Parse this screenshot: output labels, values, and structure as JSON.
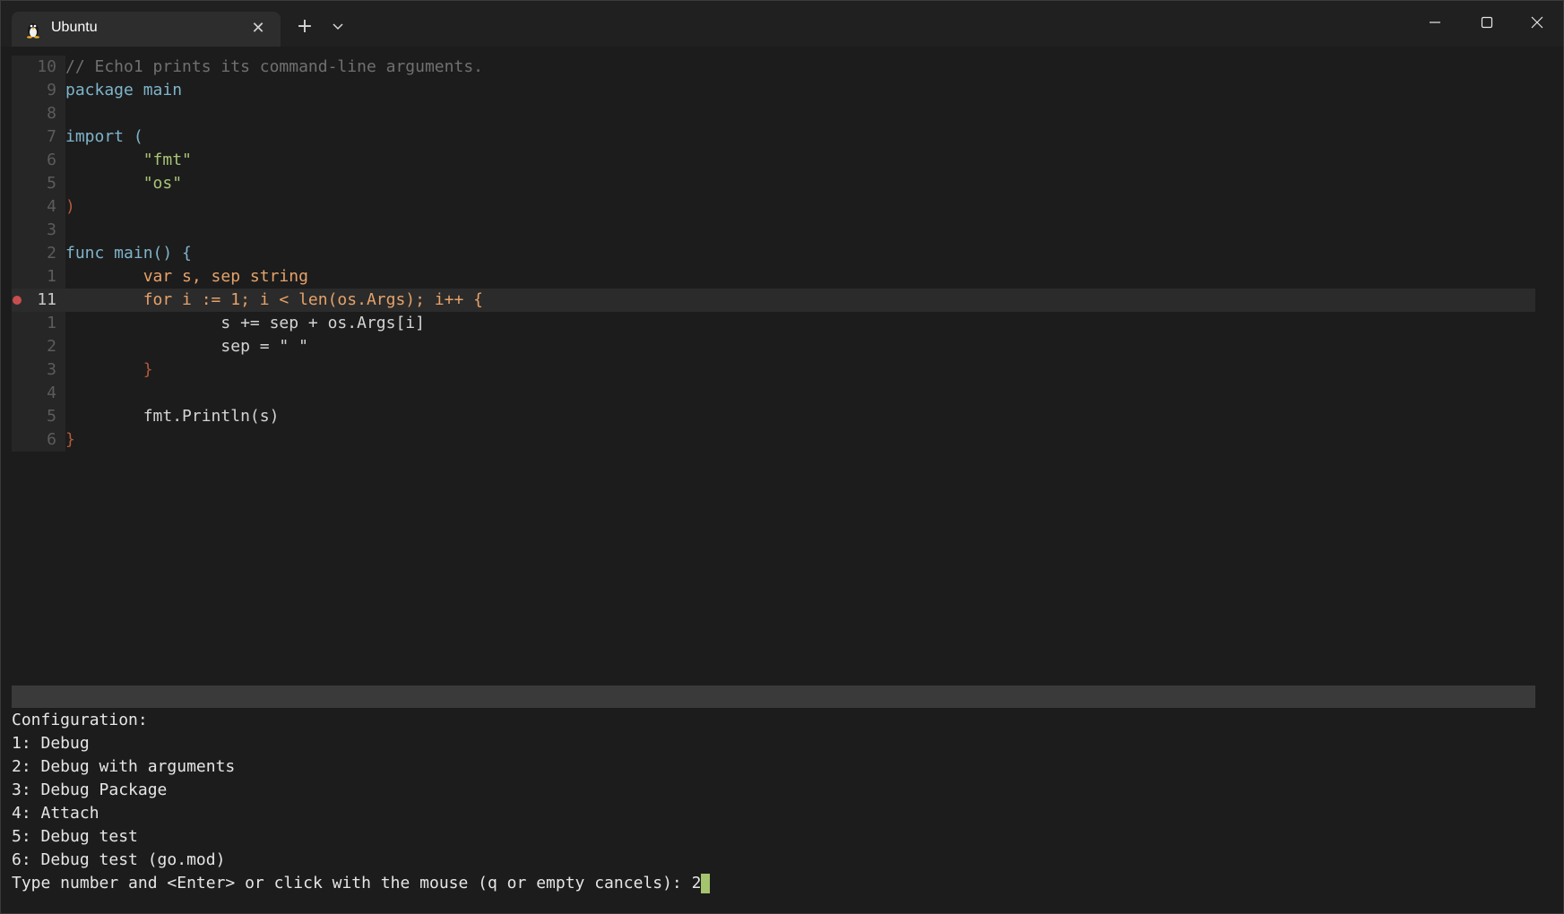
{
  "window": {
    "tab_title": "Ubuntu",
    "tab_icon": "linux-penguin-icon",
    "new_tab_icon": "plus-icon",
    "dropdown_icon": "chevron-down-icon",
    "controls": [
      "minimize-icon",
      "maximize-icon",
      "close-icon"
    ]
  },
  "editor": {
    "lines": [
      {
        "num": "10",
        "text": "// Echo1 prints its command-line arguments."
      },
      {
        "num": "9",
        "text": "package main"
      },
      {
        "num": "8",
        "text": ""
      },
      {
        "num": "7",
        "text": "import ("
      },
      {
        "num": "6",
        "text": "        \"fmt\""
      },
      {
        "num": "5",
        "text": "        \"os\""
      },
      {
        "num": "4",
        "text": ")"
      },
      {
        "num": "3",
        "text": ""
      },
      {
        "num": "2",
        "text": "func main() {"
      },
      {
        "num": "1",
        "text": "        var s, sep string"
      },
      {
        "num": "11",
        "text": "        for i := 1; i < len(os.Args); i++ {",
        "current": true,
        "breakpoint": true
      },
      {
        "num": "1",
        "text": "                s += sep + os.Args[i]"
      },
      {
        "num": "2",
        "text": "                sep = \" \""
      },
      {
        "num": "3",
        "text": "        }"
      },
      {
        "num": "4",
        "text": ""
      },
      {
        "num": "5",
        "text": "        fmt.Println(s)"
      },
      {
        "num": "6",
        "text": "}"
      }
    ]
  },
  "prompt": {
    "header": "Configuration:",
    "options": [
      "1: Debug",
      "2: Debug with arguments",
      "3: Debug Package",
      "4: Attach",
      "5: Debug test",
      "6: Debug test (go.mod)"
    ],
    "question": "Type number and <Enter> or click with the mouse (q or empty cancels): ",
    "input_value": "2"
  },
  "colors": {
    "background": "#1c1c1c",
    "breakpoint": "#c74e4e",
    "cursor": "#a4c46e",
    "keyword": "#7fb4ca",
    "string": "#a9c476",
    "comment": "#707070"
  }
}
